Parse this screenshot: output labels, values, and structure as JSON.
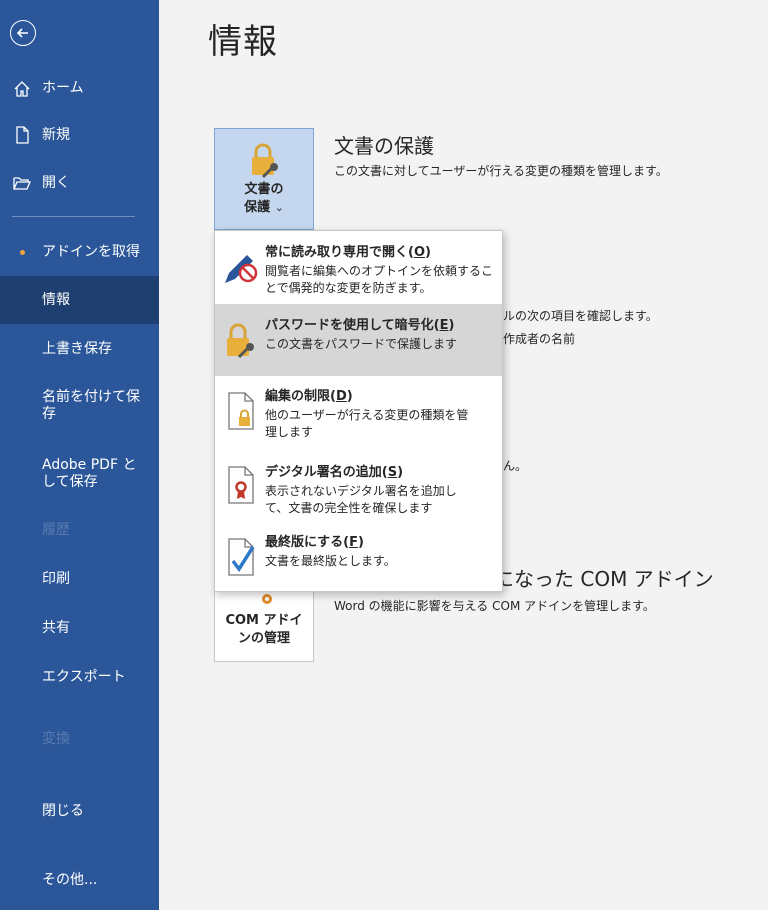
{
  "sidebar": {
    "home": "ホーム",
    "new": "新規",
    "open": "開く",
    "addins": "アドインを取得",
    "info": "情報",
    "save": "上書き保存",
    "saveas": "名前を付けて保存",
    "adobe": "Adobe PDF として保存",
    "history": "履歴",
    "print": "印刷",
    "share": "共有",
    "export": "エクスポート",
    "transform": "変換",
    "close": "閉じる",
    "more": "その他..."
  },
  "main": {
    "title": "情報",
    "protect": {
      "button_line1": "文書の",
      "button_line2": "保護",
      "chevron": "⌄",
      "heading": "文書の保護",
      "description": "この文書に対してユーザーが行える変更の種類を管理します。"
    },
    "partial": {
      "line1": "ルの次の項目を確認します。",
      "line2": "作成者の名前",
      "line3": "ん。"
    },
    "com": {
      "heading": "になった COM アドイン",
      "description": "Word の機能に影響を与える COM アドインを管理します。",
      "button_line1": "COM アドイ",
      "button_line2": "ンの管理"
    }
  },
  "menu": {
    "items": [
      {
        "title": "常に読み取り専用で開く(",
        "key": "O",
        "title_end": ")",
        "desc": "閲覧者に編集へのオプトインを依頼することで偶発的な変更を防ぎます。"
      },
      {
        "title": "パスワードを使用して暗号化(",
        "key": "E",
        "title_end": ")",
        "desc": "この文書をパスワードで保護します"
      },
      {
        "title": "編集の制限(",
        "key": "D",
        "title_end": ")",
        "desc": "他のユーザーが行える変更の種類を管理します"
      },
      {
        "title": "デジタル署名の追加(",
        "key": "S",
        "title_end": ")",
        "desc": "表示されないデジタル署名を追加して、文書の完全性を確保します"
      },
      {
        "title": "最終版にする(",
        "key": "F",
        "title_end": ")",
        "desc": "文書を最終版とします。"
      }
    ]
  },
  "colors": {
    "sidebar": "#2b579a",
    "selected": "#1e3f6f",
    "accent_dot": "#f2a23a",
    "lock": "#e8b03a"
  }
}
